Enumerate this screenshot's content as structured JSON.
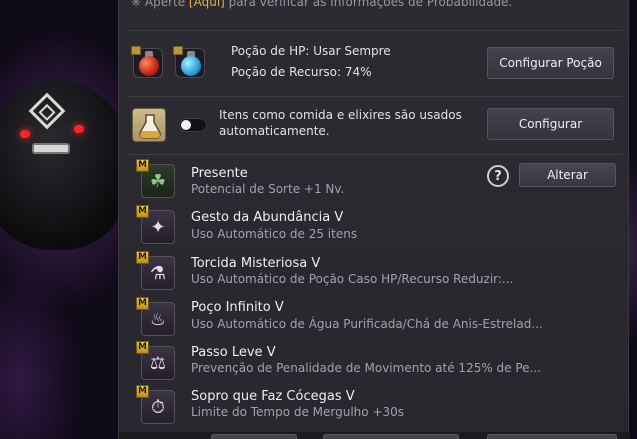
{
  "top_note": {
    "prefix": "※ Aperte ",
    "link": "[Aqui]",
    "suffix": " para verificar as Informações de Probabilidade."
  },
  "potions": {
    "hp_status": "Poção de HP: Usar Sempre",
    "resource_status": "Poção de Recurso: 74%",
    "configure_button": "Configurar Poção",
    "hp_icon": "hp-potion-icon",
    "resource_icon": "resource-potion-icon"
  },
  "auto_use": {
    "text": "Itens como comida e elixires são usados automaticamente.",
    "toggle_on": false,
    "configure_button": "Configurar",
    "icon": "flask-icon"
  },
  "help_label": "?",
  "change_button": "Alterar",
  "items": [
    {
      "badge": "M",
      "icon": "clover-icon",
      "glyph": "☘",
      "name": "Presente",
      "desc": "Potencial de Sorte +1 Nv."
    },
    {
      "badge": "M",
      "icon": "fairy-icon",
      "glyph": "✦",
      "name": "Gesto da Abundância V",
      "desc": "Uso Automático de 25 itens"
    },
    {
      "badge": "M",
      "icon": "potion-swap-icon",
      "glyph": "⚗",
      "name": "Torcida Misteriosa V",
      "desc": "Uso Automático de Poção Caso HP/Recurso Reduzir:..."
    },
    {
      "badge": "M",
      "icon": "bowl-icon",
      "glyph": "♨",
      "name": "Poço Infinito V",
      "desc": "Uso Automático de Água Purificada/Chá de Anis-Estrelad..."
    },
    {
      "badge": "M",
      "icon": "weight-icon",
      "glyph": "⚖",
      "name": "Passo Leve V",
      "desc": "Prevenção de Penalidade de Movimento até 125% de Pe..."
    },
    {
      "badge": "M",
      "icon": "timer-icon",
      "glyph": "⏱",
      "name": "Sopro que Faz Cócegas V",
      "desc": "Limite do Tempo de Mergulho +30s"
    }
  ],
  "colors": {
    "panel": "#2c2b31",
    "accent_gold": "#d9b44a",
    "badge_gold": "#f1cf4d"
  }
}
